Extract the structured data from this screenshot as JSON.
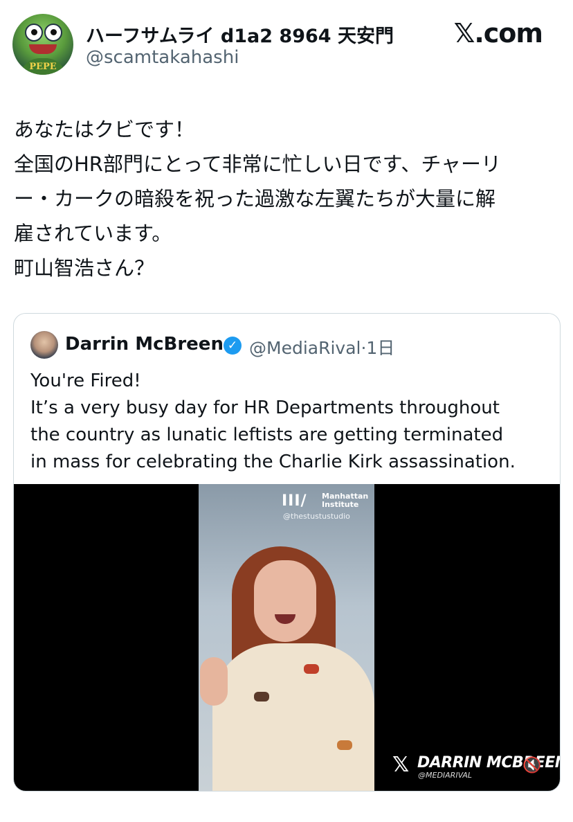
{
  "author": {
    "display_name": "ハーフサムライ d1a2 8964 天安門",
    "handle": "@scamtakahashi",
    "avatar_text": "PEPE"
  },
  "site_logo": "𝕏.com",
  "tweet": {
    "lines": [
      "あなたはクビです！",
      "全国のHR部門にとって非常に忙しい日です、チャーリ",
      "ー・カークの暗殺を祝った過激な左翼たちが大量に解",
      "雇されています。",
      "町山智浩さん？"
    ]
  },
  "quote": {
    "name": "Darrin McBreen",
    "verified_icon": "verified-badge",
    "handle": "@MediaRival",
    "separator": "·",
    "time": "1日",
    "lines": [
      "You're Fired!",
      "It’s a very busy day for HR Departments throughout",
      "the country as lunatic leftists are getting terminated",
      "in mass for celebrating the Charlie Kirk assassination."
    ],
    "video": {
      "overlay_logo": "III/",
      "overlay_org_line1": "Manhattan",
      "overlay_org_line2": "Institute",
      "overlay_source": "@thestustustudio",
      "watermark_mark": "𝕏",
      "watermark_name": "DARRIN MCBREEN",
      "watermark_handle": "@MEDIARIVAL",
      "mute_icon": "speaker-muted-icon"
    }
  },
  "colors": {
    "text": "#0f1419",
    "secondary": "#536471",
    "verified": "#1d9bf0",
    "border": "#cfd9de"
  }
}
